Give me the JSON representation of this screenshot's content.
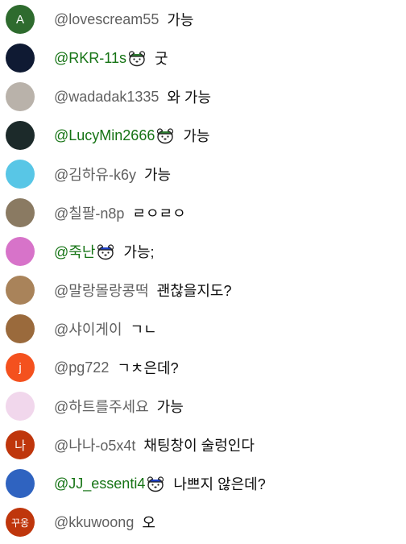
{
  "colors": {
    "author": "#606060",
    "member_author": "#157314",
    "message": "#0d0d0d"
  },
  "messages": [
    {
      "avatar_text": "A",
      "avatar_color": "#2e6b2e",
      "author": "@lovescream55",
      "member": false,
      "text": "가능"
    },
    {
      "avatar_text": "",
      "avatar_color": "#0f1a33",
      "author": "@RKR-11s",
      "member": true,
      "badge": "green-cap-bear-badge",
      "text": "굿"
    },
    {
      "avatar_text": "",
      "avatar_color": "#b9b2aa",
      "author": "@wadadak1335",
      "member": false,
      "text": "와 가능"
    },
    {
      "avatar_text": "",
      "avatar_color": "#1c2a2a",
      "author": "@LucyMin2666",
      "member": true,
      "badge": "green-cap-bear-badge",
      "text": "가능"
    },
    {
      "avatar_text": "",
      "avatar_color": "#58c6e6",
      "author": "@김하유-k6y",
      "member": false,
      "text": "가능"
    },
    {
      "avatar_text": "",
      "avatar_color": "#8a7a62",
      "author": "@칠팔-n8p",
      "member": false,
      "text": "ㄹㅇㄹㅇ"
    },
    {
      "avatar_text": "",
      "avatar_color": "#d773c9",
      "author": "@죽난",
      "member": true,
      "badge": "blue-cap-bear-badge",
      "text": "가능;"
    },
    {
      "avatar_text": "",
      "avatar_color": "#a9835a",
      "author": "@말랑몰랑콩떡",
      "member": false,
      "text": "괜찮을지도?"
    },
    {
      "avatar_text": "",
      "avatar_color": "#9a6a3c",
      "author": "@샤이게이",
      "member": false,
      "text": "ㄱㄴ"
    },
    {
      "avatar_text": "j",
      "avatar_color": "#f4511e",
      "author": "@pg722",
      "member": false,
      "text": "ㄱㅊ은데?"
    },
    {
      "avatar_text": "",
      "avatar_color": "#f1d7ec",
      "author": "@하트를주세요",
      "member": false,
      "text": "가능"
    },
    {
      "avatar_text": "나",
      "avatar_color": "#bf360c",
      "author": "@나나-o5x4t",
      "member": false,
      "text": "채팅창이 술렁인다"
    },
    {
      "avatar_text": "",
      "avatar_color": "#2f63c0",
      "author": "@JJ_essenti4",
      "member": true,
      "badge": "blue-cap-bear-badge",
      "text": "나쁘지 않은데?"
    },
    {
      "avatar_text": "꾸옹",
      "avatar_color": "#bf360c",
      "author": "@kkuwoong",
      "member": false,
      "text": "오"
    }
  ]
}
